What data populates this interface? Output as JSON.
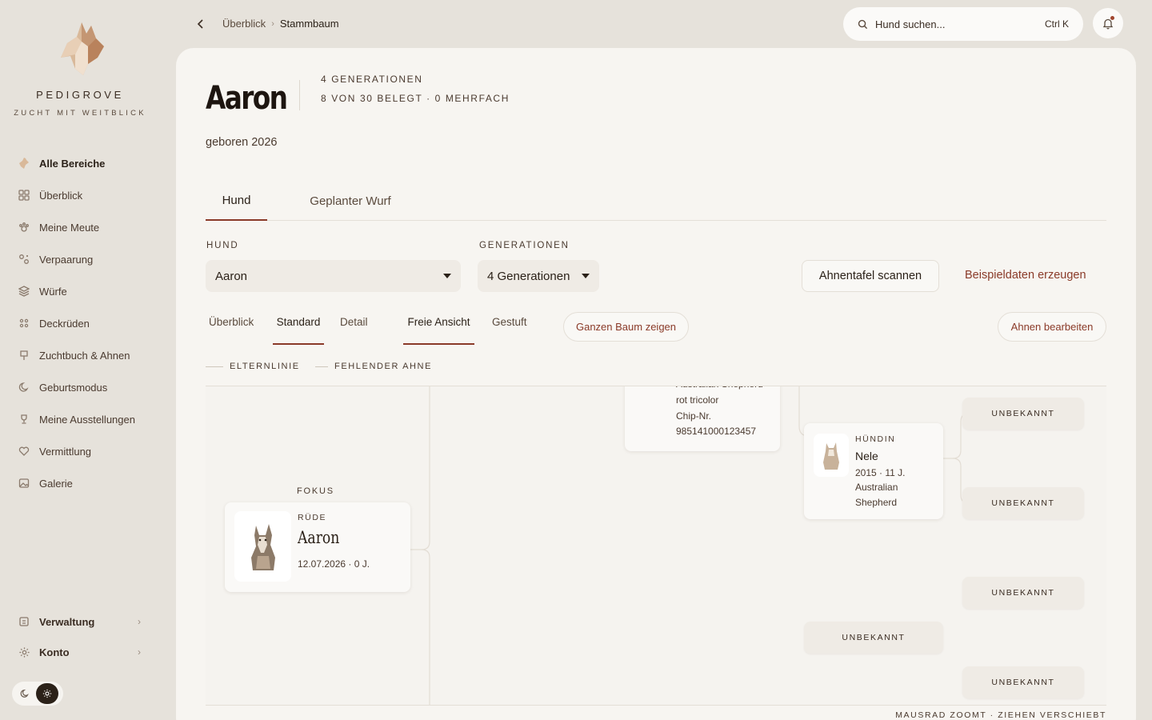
{
  "brand": {
    "name": "PEDIGROVE",
    "tagline": "ZUCHT MIT WEITBLICK"
  },
  "sidebar": {
    "items": [
      {
        "label": "Alle Bereiche",
        "icon": "dog-head-icon"
      },
      {
        "label": "Überblick",
        "icon": "grid-icon"
      },
      {
        "label": "Meine Meute",
        "icon": "paw-icon"
      },
      {
        "label": "Verpaarung",
        "icon": "pairing-icon"
      },
      {
        "label": "Würfe",
        "icon": "layers-icon"
      },
      {
        "label": "Deckrüden",
        "icon": "paws-icon"
      },
      {
        "label": "Zuchtbuch & Ahnen",
        "icon": "book-icon"
      },
      {
        "label": "Geburtsmodus",
        "icon": "moon-icon"
      },
      {
        "label": "Meine Ausstellungen",
        "icon": "trophy-icon"
      },
      {
        "label": "Vermittlung",
        "icon": "heart-icon"
      },
      {
        "label": "Galerie",
        "icon": "image-icon"
      }
    ],
    "bottom": {
      "verwaltung": "Verwaltung",
      "konto": "Konto"
    }
  },
  "topbar": {
    "breadcrumb": [
      "Überblick",
      "Stammbaum"
    ],
    "search_placeholder": "Hund suchen...",
    "search_shortcut": "Ctrl K"
  },
  "header": {
    "title": "Aaron",
    "meta_generations": "4 GENERATIONEN",
    "meta_stats": "8 VON 30 BELEGT · 0 MEHRFACH",
    "born": "geboren 2026"
  },
  "tabs": [
    "Hund",
    "Geplanter Wurf"
  ],
  "controls": {
    "hund_label": "HUND",
    "hund_value": "Aaron",
    "gen_label": "GENERATIONEN",
    "gen_value": "4 Generationen",
    "scan_button": "Ahnentafel scannen",
    "sample_button": "Beispieldaten erzeugen"
  },
  "view_tabs": [
    "Überblick",
    "Standard",
    "Detail",
    "Freie Ansicht",
    "Gestuft"
  ],
  "actions": {
    "show_tree": "Ganzen Baum zeigen",
    "edit_ancestors": "Ahnen bearbeiten"
  },
  "legend": {
    "parent_line": "ELTERNLINIE",
    "missing": "FEHLENDER AHNE"
  },
  "tree": {
    "focus_label": "FOKUS",
    "focus": {
      "sex": "RÜDE",
      "name": "Aaron",
      "info": "12.07.2026 · 0 J."
    },
    "partial_card": [
      "Australian Shepherd",
      "rot tricolor",
      "Chip-Nr.",
      "985141000123457"
    ],
    "nele": {
      "sex": "HÜNDIN",
      "name": "Nele",
      "info": "2015 · 11 J.",
      "breed1": "Australian",
      "breed2": "Shepherd"
    },
    "unknown": "UNBEKANNT"
  },
  "hint": "MAUSRAD ZOOMT · ZIEHEN VERSCHIEBT",
  "colors": {
    "accent": "#8a3a28",
    "background": "#e6e2db",
    "panel": "#f7f5f1"
  }
}
